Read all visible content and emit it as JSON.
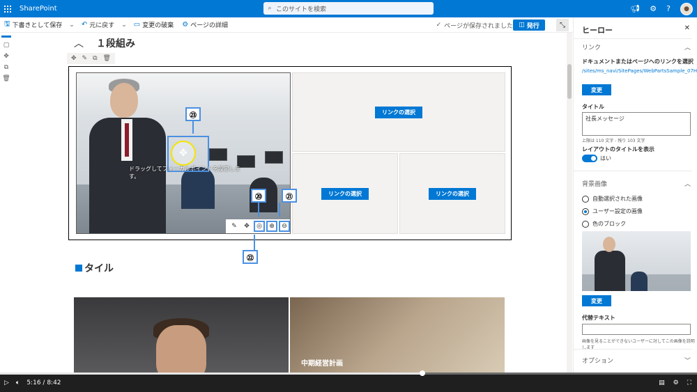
{
  "suite": {
    "app_name": "SharePoint",
    "search_placeholder": "このサイトを検索"
  },
  "command_bar": {
    "save_draft": "下書きとして保存",
    "undo": "元に戻す",
    "discard": "変更の破棄",
    "page_details": "ページの詳細",
    "saved_status": "ページが保存されました",
    "publish": "発行"
  },
  "canvas": {
    "section_title": "１段組み",
    "focal_hint": "ドラッグしてフォーカルポイントを設定します。",
    "link_select_1": "リンクの選択",
    "link_select_2": "リンクの選択",
    "link_select_3": "リンクの選択",
    "tile_heading": "タイル",
    "tile_caption": "中期経営計画"
  },
  "callouts": {
    "c20": "⑳",
    "c21": "㉑",
    "c22": "㉒",
    "c23": "㉓"
  },
  "pane": {
    "title": "ヒーロー",
    "link_section": "リンク",
    "link_label": "ドキュメントまたはページへのリンクを選択",
    "link_url": "/sites/ms_navi/SitePages/WebPartsSample_07Hero.aspx",
    "change_button_1": "変更",
    "title_label": "タイトル",
    "title_value": "社長メッセージ",
    "title_hint": "上限は 110 文字 - 残り 103 文字",
    "layout_title_label": "レイアウトのタイトルを表示",
    "toggle_state": "はい",
    "bg_section": "背景画像",
    "radio_auto": "自動選択された画像",
    "radio_custom": "ユーザー設定の画像",
    "radio_color": "色のブロック",
    "change_button_2": "変更",
    "alt_label": "代替テキスト",
    "alt_hint": "画像を見ることができないユーザーに対してこの画像を説明します",
    "options_section": "オプション"
  },
  "video": {
    "current": "5:16",
    "total": "8:42",
    "progress": 0.606
  }
}
